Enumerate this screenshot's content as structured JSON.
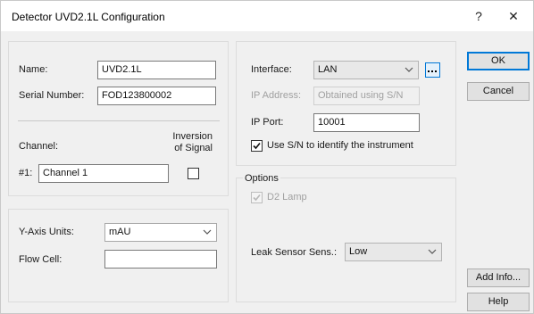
{
  "window": {
    "title": "Detector UVD2.1L Configuration",
    "help_glyph": "?",
    "close_glyph": "✕"
  },
  "general": {
    "name_label": "Name:",
    "name_value": "UVD2.1L",
    "serial_label": "Serial Number:",
    "serial_value": "FOD123800002",
    "channel_label": "Channel:",
    "inversion_label_line1": "Inversion",
    "inversion_label_line2": "of Signal",
    "channel_index_label": "#1:",
    "channel_value": "Channel 1",
    "inversion_checked": false
  },
  "axis": {
    "y_axis_units_label": "Y-Axis Units:",
    "y_axis_units_value": "mAU",
    "flow_cell_label": "Flow Cell:",
    "flow_cell_value": ""
  },
  "connection": {
    "interface_label": "Interface:",
    "interface_value": "LAN",
    "ip_address_label": "IP Address:",
    "ip_address_value": "Obtained using S/N",
    "ip_port_label": "IP Port:",
    "ip_port_value": "10001",
    "use_sn_label": "Use S/N to identify the instrument",
    "use_sn_checked": true
  },
  "options": {
    "title": "Options",
    "d2_lamp_label": "D2 Lamp",
    "d2_lamp_checked": true,
    "leak_sensor_label": "Leak Sensor Sens.:",
    "leak_sensor_value": "Low"
  },
  "buttons": {
    "ok": "OK",
    "cancel": "Cancel",
    "add_info": "Add Info...",
    "help": "Help"
  },
  "colors": {
    "dialog_bg": "#f0f0f0",
    "accent": "#0078d7"
  }
}
